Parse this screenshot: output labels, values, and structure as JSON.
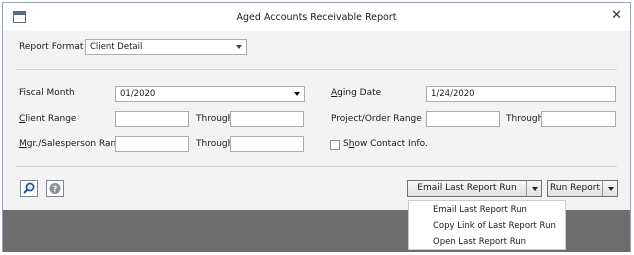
{
  "window": {
    "title": "Aged Accounts Receivable Report",
    "close_glyph": "✕",
    "icon": "app-window-icon"
  },
  "form": {
    "report_format_label": "Report Format",
    "report_format_value": "Client Detail",
    "fiscal_month_label": "Fiscal Month",
    "fiscal_month_value": "01/2020",
    "aging_date_label_u": "A",
    "aging_date_label_rest": "ging Date",
    "aging_date_value": "1/24/2020",
    "client_range_label_u": "C",
    "client_range_label_rest": "lient Range",
    "client_from": "",
    "client_through_label": "Through",
    "client_to": "",
    "project_range_label": "Project/Order Range",
    "project_from": "",
    "project_through_label": "Through",
    "project_to": "",
    "mgr_range_label_u": "M",
    "mgr_range_label_rest": "gr./Salesperson Range",
    "mgr_from": "",
    "mgr_through_label": "Through",
    "mgr_to": "",
    "show_contact_label_pre": "S",
    "show_contact_label_u": "h",
    "show_contact_label_rest": "ow Contact Info.",
    "show_contact_checked": false
  },
  "toolbar": {
    "search_icon": "magnifier-icon",
    "help_icon": "help-icon",
    "email_button_label": "Email Last Report Run",
    "run_button_label": "Run Report"
  },
  "menu": {
    "items": [
      "Email Last Report Run",
      "Copy Link of Last Report Run",
      "Open Last Report Run"
    ]
  }
}
